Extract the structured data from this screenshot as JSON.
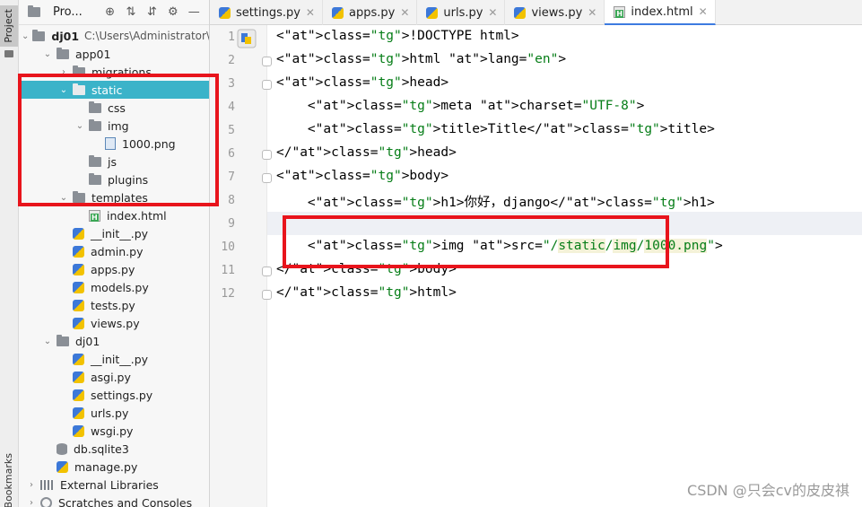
{
  "strip": {
    "project_label": "Project",
    "bookmarks_label": "Bookmarks"
  },
  "project_panel": {
    "title": "Pro...",
    "tree": [
      {
        "label": "dj01",
        "path": "C:\\Users\\Administrator\\",
        "depth": 0,
        "icon": "folder-icon",
        "arrow": "down"
      },
      {
        "label": "app01",
        "depth": 1,
        "icon": "folder-icon",
        "arrow": "down"
      },
      {
        "label": "migrations",
        "depth": 2,
        "icon": "folder-icon",
        "arrow": "right"
      },
      {
        "label": "static",
        "depth": 2,
        "icon": "folder-icon",
        "arrow": "down",
        "selected": true
      },
      {
        "label": "css",
        "depth": 3,
        "icon": "folder-icon"
      },
      {
        "label": "img",
        "depth": 3,
        "icon": "folder-icon",
        "arrow": "down"
      },
      {
        "label": "1000.png",
        "depth": 4,
        "icon": "image-file-icon"
      },
      {
        "label": "js",
        "depth": 3,
        "icon": "folder-icon"
      },
      {
        "label": "plugins",
        "depth": 3,
        "icon": "folder-icon"
      },
      {
        "label": "templates",
        "depth": 2,
        "icon": "folder-icon",
        "arrow": "down"
      },
      {
        "label": "index.html",
        "depth": 3,
        "icon": "html-file-icon"
      },
      {
        "label": "__init__.py",
        "depth": 2,
        "icon": "python-file-icon"
      },
      {
        "label": "admin.py",
        "depth": 2,
        "icon": "python-file-icon"
      },
      {
        "label": "apps.py",
        "depth": 2,
        "icon": "python-file-icon"
      },
      {
        "label": "models.py",
        "depth": 2,
        "icon": "python-file-icon"
      },
      {
        "label": "tests.py",
        "depth": 2,
        "icon": "python-file-icon"
      },
      {
        "label": "views.py",
        "depth": 2,
        "icon": "python-file-icon"
      },
      {
        "label": "dj01",
        "depth": 1,
        "icon": "folder-icon",
        "arrow": "down"
      },
      {
        "label": "__init__.py",
        "depth": 2,
        "icon": "python-file-icon"
      },
      {
        "label": "asgi.py",
        "depth": 2,
        "icon": "python-file-icon"
      },
      {
        "label": "settings.py",
        "depth": 2,
        "icon": "python-file-icon"
      },
      {
        "label": "urls.py",
        "depth": 2,
        "icon": "python-file-icon"
      },
      {
        "label": "wsgi.py",
        "depth": 2,
        "icon": "python-file-icon"
      },
      {
        "label": "db.sqlite3",
        "depth": 1,
        "icon": "database-icon"
      },
      {
        "label": "manage.py",
        "depth": 1,
        "icon": "python-file-icon"
      },
      {
        "label": "External Libraries",
        "depth": 0,
        "icon": "library-icon",
        "arrow": "right"
      },
      {
        "label": "Scratches and Consoles",
        "depth": 0,
        "icon": "scratches-icon",
        "arrow": "right"
      }
    ]
  },
  "tabs": [
    {
      "label": "settings.py",
      "icon": "python-file-icon"
    },
    {
      "label": "apps.py",
      "icon": "python-file-icon"
    },
    {
      "label": "urls.py",
      "icon": "python-file-icon"
    },
    {
      "label": "views.py",
      "icon": "python-file-icon"
    },
    {
      "label": "index.html",
      "icon": "html-file-icon",
      "active": true
    }
  ],
  "editor": {
    "line_numbers": [
      "1",
      "2",
      "3",
      "4",
      "5",
      "6",
      "7",
      "8",
      "9",
      "10",
      "11",
      "12"
    ],
    "lines": [
      "<!DOCTYPE html>",
      "<html lang=\"en\">",
      "<head>",
      "    <meta charset=\"UTF-8\">",
      "    <title>Title</title>",
      "</head>",
      "<body>",
      "    <h1>你好，django</h1>",
      "",
      "    <img src=\"/static/img/1000.png\">",
      "</body>",
      "</html>"
    ]
  },
  "watermark": "CSDN @只会cv的皮皮祺",
  "colors": {
    "selection": "#3bb3c9",
    "annotation": "#e8141c",
    "accent": "#3d7be0"
  }
}
